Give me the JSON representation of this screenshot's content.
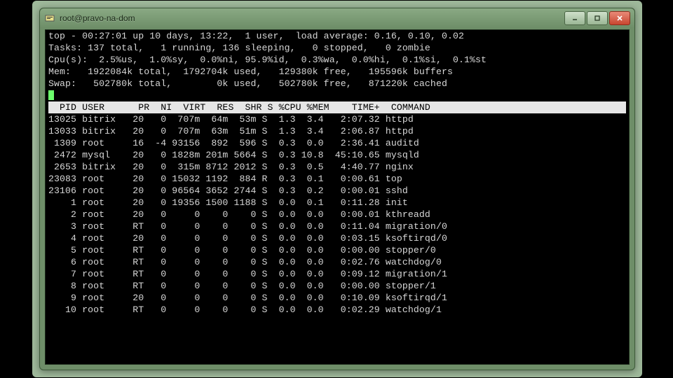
{
  "window": {
    "title": "root@pravo-na-dom"
  },
  "summary": {
    "line1": "top - 00:27:01 up 10 days, 13:22,  1 user,  load average: 0.16, 0.10, 0.02",
    "line2": "Tasks: 137 total,   1 running, 136 sleeping,   0 stopped,   0 zombie",
    "line3": "Cpu(s):  2.5%us,  1.0%sy,  0.0%ni, 95.9%id,  0.3%wa,  0.0%hi,  0.1%si,  0.1%st",
    "line4": "Mem:   1922084k total,  1792704k used,   129380k free,   195596k buffers",
    "line5": "Swap:   502780k total,        0k used,   502780k free,   871220k cached"
  },
  "columns_header": "  PID USER      PR  NI  VIRT  RES  SHR S %CPU %MEM    TIME+  COMMAND           ",
  "processes": [
    {
      "pid": "13025",
      "user": "bitrix",
      "pr": "20",
      "ni": "0",
      "virt": "707m",
      "res": "64m",
      "shr": "53m",
      "s": "S",
      "cpu": "1.3",
      "mem": "3.4",
      "time": "2:07.32",
      "cmd": "httpd"
    },
    {
      "pid": "13033",
      "user": "bitrix",
      "pr": "20",
      "ni": "0",
      "virt": "707m",
      "res": "63m",
      "shr": "51m",
      "s": "S",
      "cpu": "1.3",
      "mem": "3.4",
      "time": "2:06.87",
      "cmd": "httpd"
    },
    {
      "pid": "1309",
      "user": "root",
      "pr": "16",
      "ni": "-4",
      "virt": "93156",
      "res": "892",
      "shr": "596",
      "s": "S",
      "cpu": "0.3",
      "mem": "0.0",
      "time": "2:36.41",
      "cmd": "auditd"
    },
    {
      "pid": "2472",
      "user": "mysql",
      "pr": "20",
      "ni": "0",
      "virt": "1828m",
      "res": "201m",
      "shr": "5664",
      "s": "S",
      "cpu": "0.3",
      "mem": "10.8",
      "time": "45:10.65",
      "cmd": "mysqld"
    },
    {
      "pid": "2653",
      "user": "bitrix",
      "pr": "20",
      "ni": "0",
      "virt": "315m",
      "res": "8712",
      "shr": "2012",
      "s": "S",
      "cpu": "0.3",
      "mem": "0.5",
      "time": "4:40.77",
      "cmd": "nginx"
    },
    {
      "pid": "23083",
      "user": "root",
      "pr": "20",
      "ni": "0",
      "virt": "15032",
      "res": "1192",
      "shr": "884",
      "s": "R",
      "cpu": "0.3",
      "mem": "0.1",
      "time": "0:00.61",
      "cmd": "top"
    },
    {
      "pid": "23106",
      "user": "root",
      "pr": "20",
      "ni": "0",
      "virt": "96564",
      "res": "3652",
      "shr": "2744",
      "s": "S",
      "cpu": "0.3",
      "mem": "0.2",
      "time": "0:00.01",
      "cmd": "sshd"
    },
    {
      "pid": "1",
      "user": "root",
      "pr": "20",
      "ni": "0",
      "virt": "19356",
      "res": "1500",
      "shr": "1188",
      "s": "S",
      "cpu": "0.0",
      "mem": "0.1",
      "time": "0:11.28",
      "cmd": "init"
    },
    {
      "pid": "2",
      "user": "root",
      "pr": "20",
      "ni": "0",
      "virt": "0",
      "res": "0",
      "shr": "0",
      "s": "S",
      "cpu": "0.0",
      "mem": "0.0",
      "time": "0:00.01",
      "cmd": "kthreadd"
    },
    {
      "pid": "3",
      "user": "root",
      "pr": "RT",
      "ni": "0",
      "virt": "0",
      "res": "0",
      "shr": "0",
      "s": "S",
      "cpu": "0.0",
      "mem": "0.0",
      "time": "0:11.04",
      "cmd": "migration/0"
    },
    {
      "pid": "4",
      "user": "root",
      "pr": "20",
      "ni": "0",
      "virt": "0",
      "res": "0",
      "shr": "0",
      "s": "S",
      "cpu": "0.0",
      "mem": "0.0",
      "time": "0:03.15",
      "cmd": "ksoftirqd/0"
    },
    {
      "pid": "5",
      "user": "root",
      "pr": "RT",
      "ni": "0",
      "virt": "0",
      "res": "0",
      "shr": "0",
      "s": "S",
      "cpu": "0.0",
      "mem": "0.0",
      "time": "0:00.00",
      "cmd": "stopper/0"
    },
    {
      "pid": "6",
      "user": "root",
      "pr": "RT",
      "ni": "0",
      "virt": "0",
      "res": "0",
      "shr": "0",
      "s": "S",
      "cpu": "0.0",
      "mem": "0.0",
      "time": "0:02.76",
      "cmd": "watchdog/0"
    },
    {
      "pid": "7",
      "user": "root",
      "pr": "RT",
      "ni": "0",
      "virt": "0",
      "res": "0",
      "shr": "0",
      "s": "S",
      "cpu": "0.0",
      "mem": "0.0",
      "time": "0:09.12",
      "cmd": "migration/1"
    },
    {
      "pid": "8",
      "user": "root",
      "pr": "RT",
      "ni": "0",
      "virt": "0",
      "res": "0",
      "shr": "0",
      "s": "S",
      "cpu": "0.0",
      "mem": "0.0",
      "time": "0:00.00",
      "cmd": "stopper/1"
    },
    {
      "pid": "9",
      "user": "root",
      "pr": "20",
      "ni": "0",
      "virt": "0",
      "res": "0",
      "shr": "0",
      "s": "S",
      "cpu": "0.0",
      "mem": "0.0",
      "time": "0:10.09",
      "cmd": "ksoftirqd/1"
    },
    {
      "pid": "10",
      "user": "root",
      "pr": "RT",
      "ni": "0",
      "virt": "0",
      "res": "0",
      "shr": "0",
      "s": "S",
      "cpu": "0.0",
      "mem": "0.0",
      "time": "0:02.29",
      "cmd": "watchdog/1"
    }
  ]
}
